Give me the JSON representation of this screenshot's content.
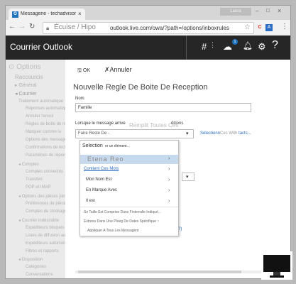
{
  "browser": {
    "tab_title": "Messagerie - techadvisor",
    "tab_icon": "O",
    "window_button": "Laura",
    "url_prefix": "Écuise / Hipo",
    "url": "outlook.live.com/owa/?path=/options/inboxrules",
    "ext_a": "A",
    "ext_b": "C"
  },
  "outlook": {
    "app_title": "Courrier Outlook",
    "badge_count": "1"
  },
  "nav": {
    "options": "Options",
    "shortcuts": "Raccourcis",
    "general": "Général",
    "mail": "Courrier",
    "items": [
      "Traitement automatique",
      "Réponses automatiques",
      "Annuler l'envoi",
      "Règles de boîte de réception",
      "Marquer comme lu",
      "Options des messages",
      "Confirmations de lecture",
      "Paramètres de réponse",
      "Comptes",
      "Comptes connectés",
      "Transfert",
      "POP et IMAP",
      "Options des pièces jointes",
      "Préférences de pièces jointes",
      "Comptes de stockage",
      "Courrier indésirable",
      "Expéditeurs bloqués",
      "Listes de diffusion autorisées",
      "Expéditeurs autorisés",
      "Filtres et rapports",
      "Disposition",
      "Catégories",
      "Conversations"
    ]
  },
  "dialog": {
    "save_label": "OK",
    "cancel_label": "Annuler",
    "title": "Nouvelle Regle De Boite De Reception",
    "name_label": "Nom",
    "name_value": "Famille",
    "condition_label": "Lorsque le message arrive",
    "condition_overlay": "Remplit Toutes Ces",
    "condition_label_end": "ditions",
    "condition_placeholder": "Faire Reste De -",
    "select_link": "Sélectionn",
    "select_link_gray": "Ces With",
    "select_link_end": "tacts...",
    "right_link": "rille ?)"
  },
  "menu": {
    "header": "Selection",
    "header_sub": "er un élément...",
    "items": [
      "Etena Reo",
      "Contient Ces Mots",
      "Mon Nom Est",
      "En Marque Avec",
      "Il est",
      "Se Taille Est Comprise Dans Finterralle Indiqué...",
      "Estreou Dans Une Ploeg De Dates Spécifique ~",
      "Appliquer A Tous Les Messagent"
    ]
  }
}
